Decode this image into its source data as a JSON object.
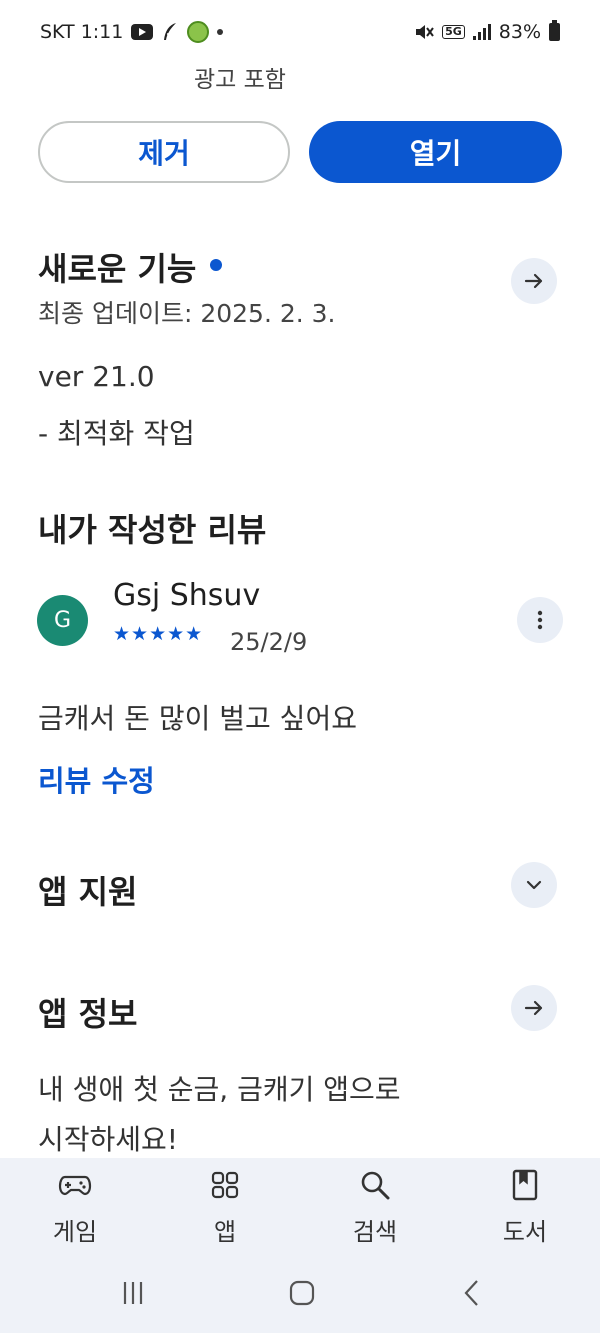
{
  "status_bar": {
    "carrier_time": "SKT 1:11",
    "network": "5G",
    "battery": "83%"
  },
  "header": {
    "ad_notice": "광고 포함",
    "remove_label": "제거",
    "open_label": "열기"
  },
  "whats_new": {
    "title": "새로운 기능",
    "last_updated": "최종 업데이트: 2025. 2. 3.",
    "version": "ver 21.0",
    "notes": "- 최적화 작업"
  },
  "my_review": {
    "title": "내가 작성한 리뷰",
    "avatar_letter": "G",
    "reviewer": "Gsj Shsuv",
    "stars": "★★★★★",
    "rating": 5,
    "date": "25/2/9",
    "text": "금캐서 돈 많이 벌고 싶어요",
    "edit_label": "리뷰 수정"
  },
  "app_support": {
    "title": "앱 지원"
  },
  "app_info": {
    "title": "앱 정보",
    "line1": "내 생애 첫 순금, 금캐기 앱으로",
    "line2": "시작하세요!"
  },
  "bottom_nav": {
    "items": [
      {
        "label": "게임",
        "icon": "gamepad-icon"
      },
      {
        "label": "앱",
        "icon": "apps-grid-icon"
      },
      {
        "label": "검색",
        "icon": "search-icon"
      },
      {
        "label": "도서",
        "icon": "book-icon"
      }
    ]
  },
  "colors": {
    "accent": "#0b57d0",
    "avatar": "#1a8a73",
    "nav_bg": "#eff2f8",
    "circle_btn_bg": "#e9eef6"
  }
}
